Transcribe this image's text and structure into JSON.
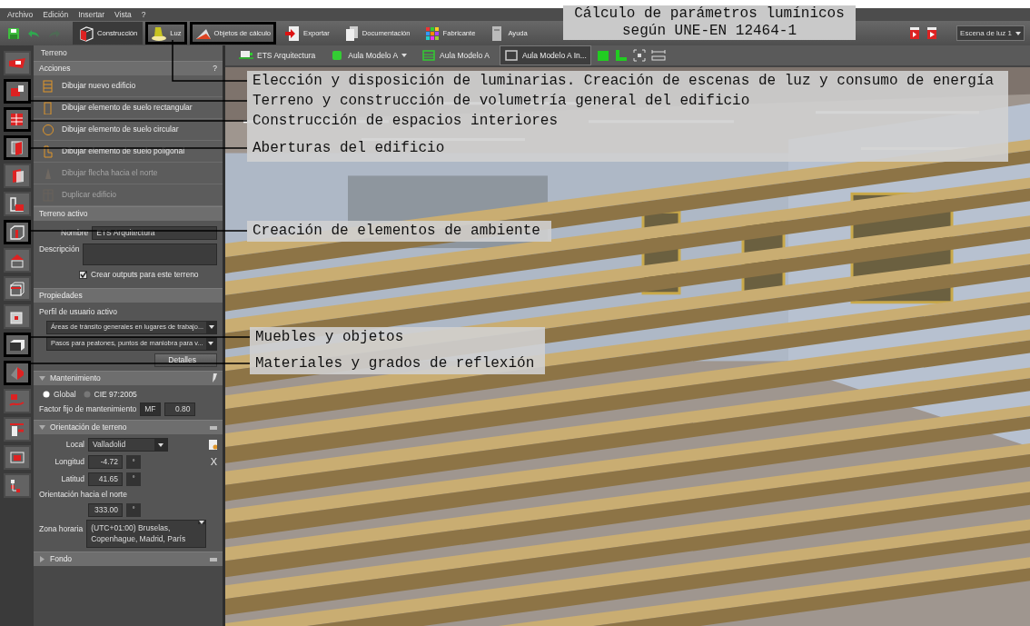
{
  "menu": [
    {
      "label": "Archivo"
    },
    {
      "label": "Edición"
    },
    {
      "label": "Insertar"
    },
    {
      "label": "Vista"
    },
    {
      "label": "?"
    }
  ],
  "toolbar": {
    "undo_enabled": true,
    "redo_enabled": false,
    "tabs": [
      {
        "label": "Construcción",
        "selected": true,
        "highlighted": false
      },
      {
        "label": "Luz",
        "selected": false,
        "highlighted": true
      },
      {
        "label": "Objetos de cálculo",
        "selected": false,
        "highlighted": true
      },
      {
        "label": "Exportar",
        "selected": false,
        "highlighted": false
      },
      {
        "label": "Documentación",
        "selected": false,
        "highlighted": false
      },
      {
        "label": "Fabricante",
        "selected": false,
        "highlighted": false
      },
      {
        "label": "Ayuda",
        "selected": false,
        "highlighted": false
      }
    ],
    "scene": "Escena de luz 1"
  },
  "title_note": {
    "lines": [
      "Cálculo de parámetros lumínicos",
      "según UNE-EN 12464-1"
    ]
  },
  "side_tools": [
    {
      "highlighted": false
    },
    {
      "highlighted": true
    },
    {
      "highlighted": true
    },
    {
      "highlighted": true
    },
    {
      "highlighted": false
    },
    {
      "highlighted": false
    },
    {
      "highlighted": true
    },
    {
      "highlighted": false
    },
    {
      "highlighted": false
    },
    {
      "highlighted": false
    },
    {
      "highlighted": true
    },
    {
      "highlighted": true
    },
    {
      "highlighted": false
    },
    {
      "highlighted": false
    },
    {
      "highlighted": false
    },
    {
      "highlighted": false
    }
  ],
  "panel": {
    "title": "Terreno",
    "actions": {
      "header": "Acciones",
      "help": "?",
      "items": [
        {
          "label": "Dibujar nuevo edificio",
          "disabled": false
        },
        {
          "label": "Dibujar elemento de suelo rectangular",
          "disabled": false
        },
        {
          "label": "Dibujar elemento de suelo circular",
          "disabled": false
        },
        {
          "label": "Dibujar elemento de suelo poligonal",
          "disabled": false
        },
        {
          "label": "Dibujar flecha hacia el norte",
          "disabled": true
        },
        {
          "label": "Duplicar edificio",
          "disabled": true
        }
      ]
    },
    "active": {
      "header": "Terreno activo",
      "name_label": "Nombre",
      "name_value": "ETS Arquitectura",
      "desc_label": "Descripción",
      "output_label": "Crear outputs para este terreno",
      "output_checked": true
    },
    "properties": {
      "header": "Propiedades",
      "profile_label": "Perfil de usuario activo",
      "selects": [
        "Áreas de tránsito generales en lugares de trabajo...",
        "Pasos para peatones, puntos de maniobra para v..."
      ],
      "details": "Detalles"
    },
    "maintenance": {
      "header": "Mantenimiento",
      "expanded": true,
      "modes": [
        {
          "label": "Global",
          "selected": true
        },
        {
          "label": "CIE 97:2005",
          "selected": false
        }
      ],
      "factor_label": "Factor fijo de mantenimiento",
      "factor_unit": "MF",
      "factor_value": "0.80"
    },
    "orientation": {
      "header": "Orientación de terreno",
      "expanded": true,
      "local_label": "Local",
      "local_value": "Valladolid",
      "close": "X",
      "lon_label": "Longitud",
      "lon_value": "-4.72",
      "lon_unit": "°",
      "lat_label": "Latitud",
      "lat_value": "41.65",
      "lat_unit": "°",
      "north_label": "Orientación hacia el norte",
      "north_value": "333.00",
      "north_unit": "°",
      "tz_label": "Zona horaria",
      "tz_value": "(UTC+01:00) Bruselas, Copenhague, Madrid, París"
    },
    "background": {
      "header": "Fondo",
      "expanded": false
    }
  },
  "view_tabs": [
    {
      "label": "ETS Arquitectura",
      "selected": false,
      "dropdown": false
    },
    {
      "label": "Aula Modelo A",
      "selected": false,
      "dropdown": true
    },
    {
      "label": "Aula Modelo A",
      "selected": false,
      "dropdown": false
    },
    {
      "label": "Aula Modelo A In...",
      "selected": true,
      "dropdown": false
    }
  ],
  "callouts": [
    {
      "lines": [
        "Elección y disposición de luminarias. Creación de escenas de luz y consumo de energía",
        "Terreno y construcción de volumetría general del edificio",
        "Construcción de espacios interiores",
        "Aberturas del edificio"
      ]
    },
    {
      "lines": [
        "Creación de elementos de ambiente"
      ]
    },
    {
      "lines": [
        "Muebles y objetos",
        "Materiales y grados de reflexión"
      ]
    }
  ]
}
